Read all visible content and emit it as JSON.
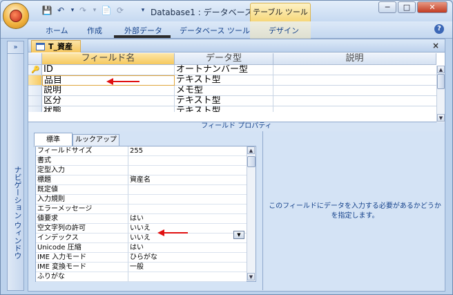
{
  "window": {
    "title": "Database1 : データベース ...",
    "context_tab": "テーブル ツール",
    "min": "─",
    "max": "□",
    "close": "✕"
  },
  "quick_access": {
    "save": "💾",
    "undo": "↶",
    "redo": "↷",
    "new": "📄"
  },
  "ribbon": {
    "tabs": [
      "ホーム",
      "作成",
      "外部データ",
      "データベース ツール",
      "デザイン"
    ],
    "help": "?"
  },
  "nav": {
    "label": "ナビゲーション ウィンドウ",
    "toggle": "»"
  },
  "document": {
    "tab_label": "T_資産",
    "close": "×"
  },
  "design_grid": {
    "headers": [
      "フィールド名",
      "データ型",
      "説明"
    ],
    "rows": [
      {
        "name": "ID",
        "type": "オートナンバー型",
        "primary_key": true
      },
      {
        "name": "品目",
        "type": "テキスト型"
      },
      {
        "name": "説明",
        "type": "メモ型"
      },
      {
        "name": "区分",
        "type": "テキスト型"
      },
      {
        "name": "状態",
        "type": "テキスト型"
      }
    ]
  },
  "properties": {
    "title": "フィールド プロパティ",
    "tabs": [
      "標準",
      "ルックアップ"
    ],
    "rows": [
      {
        "label": "フィールドサイズ",
        "value": "255"
      },
      {
        "label": "書式",
        "value": ""
      },
      {
        "label": "定型入力",
        "value": ""
      },
      {
        "label": "標題",
        "value": "資産名"
      },
      {
        "label": "既定値",
        "value": ""
      },
      {
        "label": "入力規則",
        "value": ""
      },
      {
        "label": "エラーメッセージ",
        "value": ""
      },
      {
        "label": "値要求",
        "value": "はい"
      },
      {
        "label": "空文字列の許可",
        "value": "いいえ"
      },
      {
        "label": "インデックス",
        "value": "いいえ"
      },
      {
        "label": "Unicode 圧縮",
        "value": "はい"
      },
      {
        "label": "IME 入力モード",
        "value": "ひらがな"
      },
      {
        "label": "IME 変換モード",
        "value": "一般"
      },
      {
        "label": "ふりがな",
        "value": ""
      }
    ],
    "help_text": "このフィールドにデータを入力する必要があるかどうかを指定します。"
  },
  "colors": {
    "accent": "#f5c65d",
    "arrow": "#e01010",
    "ribbon_text": "#15428b"
  }
}
